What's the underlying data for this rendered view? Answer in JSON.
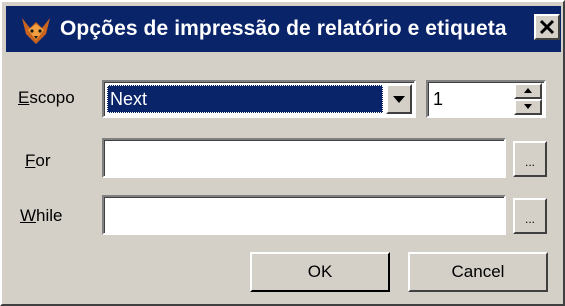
{
  "window": {
    "title": "Opções de impressão de relatório e etiqueta",
    "app_icon": "fox-icon",
    "close_icon": "close-icon"
  },
  "form": {
    "scope": {
      "label_hotkey": "E",
      "label_rest": "scopo",
      "selected": "Next",
      "count": "1"
    },
    "for": {
      "label_hotkey": "F",
      "label_rest": "or",
      "value": "",
      "browse_label": "..."
    },
    "while": {
      "label_hotkey": "W",
      "label_rest": "hile",
      "value": "",
      "browse_label": "..."
    }
  },
  "buttons": {
    "ok_label": "OK",
    "cancel_label": "Cancel"
  }
}
